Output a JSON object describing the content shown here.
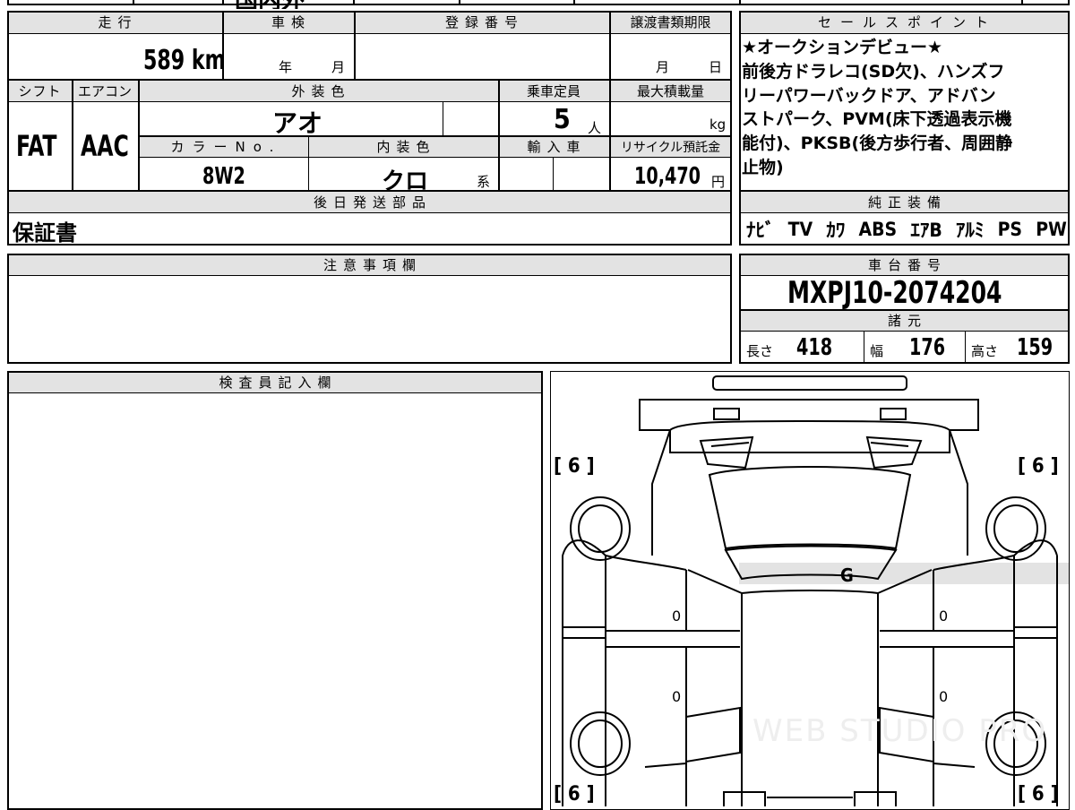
{
  "top_strip": {
    "partial_text": "国内外"
  },
  "headers": {
    "mileage": "走行",
    "inspection": "車検",
    "registration": "登録番号",
    "transfer_deadline": "譲渡書類期限",
    "shift": "シフト",
    "aircon": "エアコン",
    "exterior_color": "外装色",
    "capacity": "乗車定員",
    "max_load": "最大積載量",
    "color_no": "カラーNo.",
    "interior_color": "内装色",
    "import": "輸入車",
    "recycle": "リサイクル預託金",
    "later_parts": "後日発送部品",
    "sales_points": "セールスポイント",
    "genuine_equipment": "純正装備",
    "notes": "注意事項欄",
    "chassis_number": "車台番号",
    "specs": "諸元",
    "inspector_notes": "検査員記入欄"
  },
  "values": {
    "mileage": "589",
    "mileage_unit": "km",
    "year_unit": "年",
    "month_unit": "月",
    "transfer_month": "月",
    "transfer_day": "日",
    "shift": "FAT",
    "aircon": "AAC",
    "exterior_color": "アオ",
    "capacity": "5",
    "capacity_unit": "人",
    "load_unit": "kg",
    "color_no": "8W2",
    "interior_color": "クロ",
    "interior_suffix": "系",
    "recycle_fee": "10,470",
    "recycle_unit": "円",
    "later_parts": "保証書",
    "chassis_number": "MXPJ10-2074204",
    "length_label": "長さ",
    "length": "418",
    "width_label": "幅",
    "width": "176",
    "height_label": "高さ",
    "height": "159"
  },
  "sales_point_lines": [
    "★オークションデビュー★",
    "前後方ドラレコ(SD欠)、ハンズフ",
    "リーパワーバックドア、アドバン",
    "ストパーク、PVM(床下透過表示機",
    "能付)、PKSB(後方歩行者、周囲静",
    "止物)"
  ],
  "equipment": [
    "ﾅﾋﾞ",
    "TV",
    "ｶﾜ",
    "ABS",
    "ｴｱB",
    "ｱﾙﾐ",
    "PS",
    "PW"
  ],
  "diagram": {
    "tire_tl": "[ 6 ]",
    "tire_tr": "[ 6 ]",
    "tire_bl": "[ 6 ]",
    "tire_br": "[ 6 ]",
    "glass_grade": "G",
    "left_front_door": "0",
    "left_rear_door": "0",
    "right_front_door": "0",
    "right_rear_door": "0",
    "watermark": "WEB STUDIO PRO"
  }
}
